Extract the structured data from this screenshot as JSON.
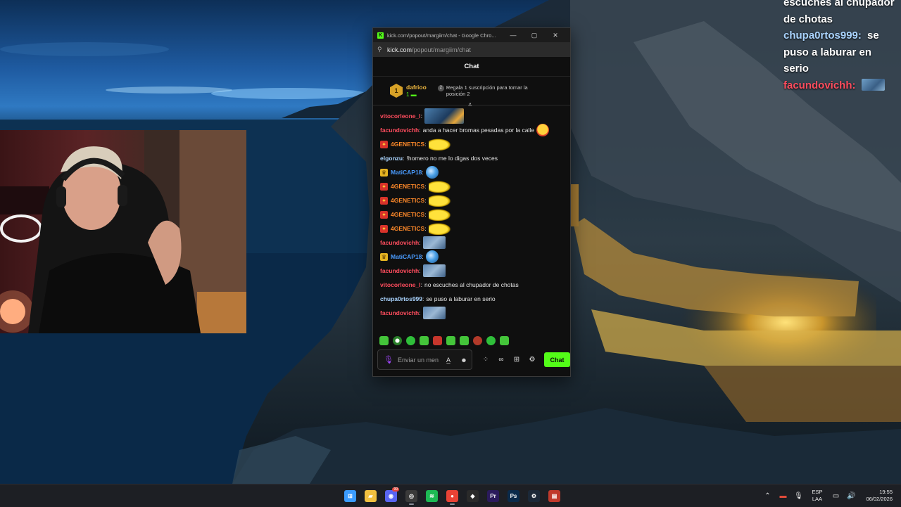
{
  "overlay_chat": [
    {
      "user": "",
      "user_color": "#ffffff",
      "text": "escuches al chupador de chotas"
    },
    {
      "user": "chupa0rtos999:",
      "user_color": "#aad4ff",
      "text": "se puso a laburar en serio"
    },
    {
      "user": "facundovichh:",
      "user_color": "#ff4d5e",
      "text": ""
    }
  ],
  "window": {
    "title": "kick.com/popout/margiim/chat - Google Chro...",
    "minimize_glyph": "—",
    "maximize_glyph": "▢",
    "close_glyph": "✕",
    "url_host": "kick.com",
    "url_path": "/popout/margiim/chat",
    "accent_color": "#53fc18"
  },
  "chat": {
    "header": "Chat",
    "leaderboard": {
      "rank": "1",
      "name": "dafrioo",
      "count": "1",
      "slot": "2",
      "cta": "Regala 1 suscripción para tomar la posición 2"
    },
    "messages": [
      {
        "badge": "",
        "user": "vitocorleone_l",
        "user_color": "#ff4d5e",
        "text": "",
        "emote": "wide"
      },
      {
        "badge": "",
        "user": "facundovichh",
        "user_color": "#ff4d5e",
        "text": "anda a hacer bromas pesadas por la calle",
        "emote": "laugh"
      },
      {
        "badge": "fire",
        "user": "4GENETICS",
        "user_color": "#ff8a2a",
        "text": "",
        "emote": "pika"
      },
      {
        "badge": "",
        "user": "elgonzu",
        "user_color": "#aad4ff",
        "text": "!homero no me lo digas dos veces",
        "emote": ""
      },
      {
        "badge": "crown",
        "user": "MatiCAP18",
        "user_color": "#4a9cff",
        "text": "",
        "emote": "globe"
      },
      {
        "badge": "fire",
        "user": "4GENETICS",
        "user_color": "#ff8a2a",
        "text": "",
        "emote": "pika"
      },
      {
        "badge": "fire",
        "user": "4GENETICS",
        "user_color": "#ff8a2a",
        "text": "",
        "emote": "pika"
      },
      {
        "badge": "fire",
        "user": "4GENETICS",
        "user_color": "#ff8a2a",
        "text": "",
        "emote": "pika"
      },
      {
        "badge": "fire",
        "user": "4GENETICS",
        "user_color": "#ff8a2a",
        "text": "",
        "emote": "pika"
      },
      {
        "badge": "",
        "user": "facundovichh",
        "user_color": "#ff4d5e",
        "text": "",
        "emote": "face"
      },
      {
        "badge": "crown",
        "user": "MatiCAP18",
        "user_color": "#4a9cff",
        "text": "",
        "emote": "globe"
      },
      {
        "badge": "",
        "user": "facundovichh",
        "user_color": "#ff4d5e",
        "text": "",
        "emote": "face"
      },
      {
        "badge": "",
        "user": "vitocorleone_l",
        "user_color": "#ff4d5e",
        "text": "no escuches al chupador de chotas",
        "emote": ""
      },
      {
        "badge": "",
        "user": "chupa0rtos999",
        "user_color": "#aad4ff",
        "text": "se puso a laburar en serio",
        "emote": ""
      },
      {
        "badge": "",
        "user": "facundovichh",
        "user_color": "#ff4d5e",
        "text": "",
        "emote": "face"
      }
    ],
    "input_placeholder": "Enviar un mensaje",
    "send_label": "Chat"
  },
  "taskbar": {
    "apps": [
      {
        "name": "windows-start",
        "glyph": "⊞",
        "color": "#3b9cff",
        "notif": ""
      },
      {
        "name": "file-explorer",
        "glyph": "▰",
        "color": "#f2c040",
        "notif": ""
      },
      {
        "name": "discord",
        "glyph": "◉",
        "color": "#5865f2",
        "notif": "99"
      },
      {
        "name": "obs",
        "glyph": "◎",
        "color": "#3a3a3a",
        "notif": ""
      },
      {
        "name": "spotify",
        "glyph": "≋",
        "color": "#1db954",
        "notif": ""
      },
      {
        "name": "chrome",
        "glyph": "●",
        "color": "#e94235",
        "notif": ""
      },
      {
        "name": "epic-games",
        "glyph": "◆",
        "color": "#2a2a2a",
        "notif": ""
      },
      {
        "name": "premiere-pro",
        "glyph": "Pr",
        "color": "#2b1a5c",
        "notif": ""
      },
      {
        "name": "photoshop",
        "glyph": "Ps",
        "color": "#0a2a4a",
        "notif": ""
      },
      {
        "name": "steam",
        "glyph": "⚙",
        "color": "#1b2838",
        "notif": ""
      },
      {
        "name": "voicemeeter",
        "glyph": "▤",
        "color": "#c0392b",
        "notif": ""
      }
    ],
    "language": "ESP",
    "layout": "LAA",
    "time": "19:55",
    "date": "06/02/2026"
  }
}
